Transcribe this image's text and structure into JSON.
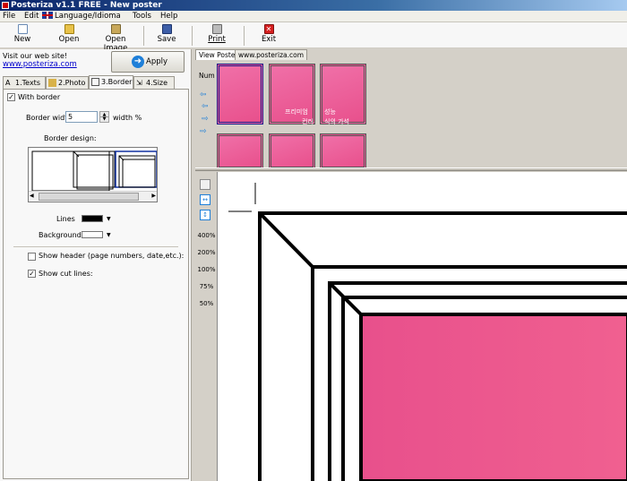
{
  "window": {
    "title": "Posteriza v1.1 FREE - New poster"
  },
  "menu": {
    "file": "File",
    "edit": "Edit",
    "language": "Language/Idioma",
    "tools": "Tools",
    "help": "Help"
  },
  "toolbar": {
    "new": "New",
    "open": "Open",
    "open_image": "Open Image",
    "save": "Save",
    "print": "Print",
    "exit": "Exit"
  },
  "website": {
    "prompt": "Visit our web site!",
    "url": "www.posteriza.com"
  },
  "apply": {
    "label": "Apply"
  },
  "tabs": {
    "texts": "1.Texts",
    "photo": "2.Photo",
    "border": "3.Border",
    "size": "4.Size"
  },
  "border": {
    "with_border": "With border",
    "width_label": "Border width",
    "width_value": "5",
    "width_unit": "width %",
    "design_label": "Border design:",
    "lines_label": "Lines",
    "lines_color": "#000000",
    "background_label": "Background",
    "background_color": "#ffffff",
    "show_header": "Show header (page numbers, date,etc.):",
    "show_cut_lines": "Show cut lines:"
  },
  "view_tabs": {
    "view_poster": "View Poster",
    "website": "www.posteriza.com"
  },
  "thumbs": {
    "num": "Num",
    "text_line1": "프리미엄",
    "text_line1b": "성능",
    "text_line2": "컨러",
    "text_line2b": "식의 가석"
  },
  "zoom": {
    "z400": "400%",
    "z200": "200%",
    "z100": "100%",
    "z75": "75%",
    "z50": "50%"
  },
  "colors": {
    "accent": "#e8508c",
    "title_bar": "#0a246a"
  }
}
